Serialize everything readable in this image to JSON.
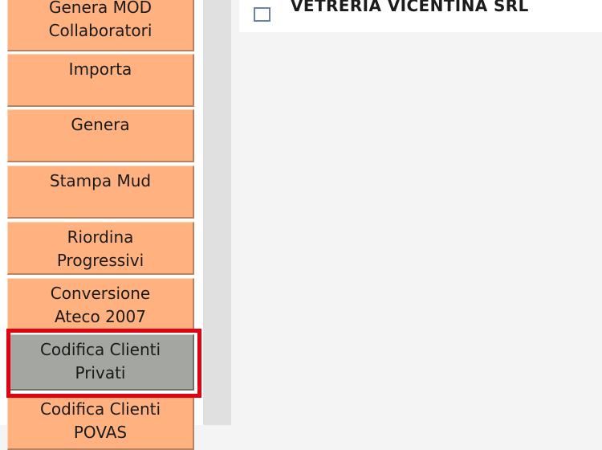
{
  "sidebar": {
    "items": [
      {
        "label": "Genera MOD\nCollaboratori"
      },
      {
        "label": "Importa"
      },
      {
        "label": "Genera"
      },
      {
        "label": "Stampa Mud"
      },
      {
        "label": "Riordina\nProgressivi"
      },
      {
        "label": "Conversione\nAteco 2007"
      },
      {
        "label": "Codifica Clienti\nPrivati",
        "selected": true
      },
      {
        "label": "Codifica Clienti\nPOVAS"
      }
    ]
  },
  "main": {
    "list": {
      "items": [
        {
          "label": "VETRERIA VICENTINA SRL",
          "checked": false
        }
      ]
    }
  },
  "colors": {
    "button_bg": "#ffb27f",
    "button_selected_bg": "#a3a6a1",
    "highlight_border": "#e3000f"
  }
}
